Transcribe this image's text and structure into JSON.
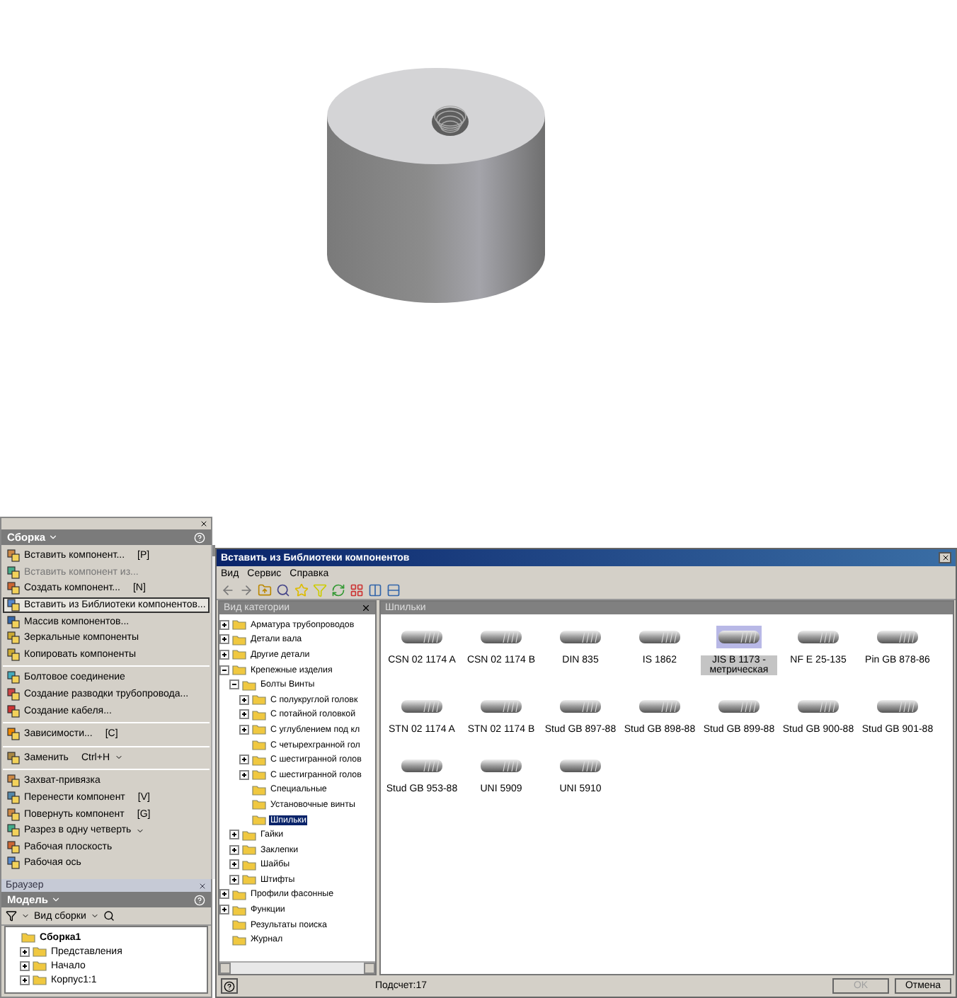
{
  "panel": {
    "title": "Сборка",
    "items": [
      {
        "kind": "item",
        "label": "Вставить компонент...",
        "shortcut": "[P]",
        "disabled": false,
        "selected": false,
        "dropdown": false
      },
      {
        "kind": "item",
        "label": "Вставить компонент из...",
        "disabled": true,
        "selected": false,
        "dropdown": false
      },
      {
        "kind": "item",
        "label": "Создать компонент...",
        "shortcut": "[N]",
        "disabled": false,
        "selected": false,
        "dropdown": false
      },
      {
        "kind": "item",
        "label": "Вставить из Библиотеки компонентов...",
        "disabled": false,
        "selected": true,
        "dropdown": false
      },
      {
        "kind": "item",
        "label": "Массив компонентов...",
        "disabled": false,
        "selected": false,
        "dropdown": false
      },
      {
        "kind": "item",
        "label": "Зеркальные компоненты",
        "disabled": false,
        "selected": false,
        "dropdown": false
      },
      {
        "kind": "item",
        "label": "Копировать компоненты",
        "disabled": false,
        "selected": false,
        "dropdown": false
      },
      {
        "kind": "separator"
      },
      {
        "kind": "item",
        "label": "Болтовое соединение",
        "disabled": false,
        "selected": false,
        "dropdown": false
      },
      {
        "kind": "item",
        "label": "Создание разводки трубопровода...",
        "disabled": false,
        "selected": false,
        "dropdown": false
      },
      {
        "kind": "item",
        "label": "Создание кабеля...",
        "disabled": false,
        "selected": false,
        "dropdown": false
      },
      {
        "kind": "separator"
      },
      {
        "kind": "item",
        "label": "Зависимости...",
        "shortcut": "[C]",
        "disabled": false,
        "selected": false,
        "dropdown": false
      },
      {
        "kind": "separator"
      },
      {
        "kind": "item",
        "label": "Заменить",
        "shortcut": "Ctrl+H",
        "disabled": false,
        "selected": false,
        "dropdown": true
      },
      {
        "kind": "separator"
      },
      {
        "kind": "item",
        "label": "Захват-привязка",
        "disabled": false,
        "selected": false,
        "dropdown": false
      },
      {
        "kind": "item",
        "label": "Перенести компонент",
        "shortcut": "[V]",
        "disabled": false,
        "selected": false,
        "dropdown": false
      },
      {
        "kind": "item",
        "label": "Повернуть компонент",
        "shortcut": "[G]",
        "disabled": false,
        "selected": false,
        "dropdown": false
      },
      {
        "kind": "item",
        "label": "Разрез в одну четверть",
        "disabled": false,
        "selected": false,
        "dropdown": true
      },
      {
        "kind": "item",
        "label": "Рабочая плоскость",
        "disabled": false,
        "selected": false,
        "dropdown": false
      },
      {
        "kind": "item",
        "label": "Рабочая ось",
        "disabled": false,
        "selected": false,
        "dropdown": false
      }
    ]
  },
  "browser": {
    "title": "Браузер",
    "tab": "Модель",
    "view": "Вид сборки",
    "tree": [
      {
        "label": "Сборка1",
        "selected": false,
        "children": [
          {
            "label": "Представления",
            "expanded": false,
            "selected": false
          },
          {
            "label": "Начало",
            "expanded": false,
            "selected": false
          },
          {
            "label": "Корпус1:1",
            "expanded": false,
            "selected": false
          }
        ]
      }
    ]
  },
  "dialog": {
    "title": "Вставить из Библиотеки компонентов",
    "menu": [
      "Вид",
      "Сервис",
      "Справка"
    ],
    "categories_title": "Вид категории",
    "tree": [
      {
        "label": "Арматура трубопроводов",
        "expanded": false,
        "selected": false
      },
      {
        "label": "Детали вала",
        "expanded": false,
        "selected": false
      },
      {
        "label": "Другие детали",
        "expanded": false,
        "selected": false
      },
      {
        "label": "Крепежные изделия",
        "expanded": true,
        "selected": false,
        "children": [
          {
            "label": "Болты Винты",
            "expanded": true,
            "selected": false,
            "children": [
              {
                "label": "С полукруглой головк",
                "expanded": false,
                "selected": false
              },
              {
                "label": "С потайной головкой",
                "expanded": false,
                "selected": false
              },
              {
                "label": "С углублением под кл",
                "expanded": false,
                "selected": false
              },
              {
                "label": "С четырехгранной гол",
                "selected": false
              },
              {
                "label": "С шестигранной голов",
                "expanded": false,
                "selected": false
              },
              {
                "label": "С шестигранной голов",
                "expanded": false,
                "selected": false
              },
              {
                "label": "Специальные",
                "selected": false
              },
              {
                "label": "Установочные винты",
                "selected": false
              },
              {
                "label": "Шпильки",
                "selected": true
              }
            ]
          },
          {
            "label": "Гайки",
            "expanded": false,
            "selected": false
          },
          {
            "label": "Заклепки",
            "expanded": false,
            "selected": false
          },
          {
            "label": "Шайбы",
            "expanded": false,
            "selected": false
          },
          {
            "label": "Штифты",
            "expanded": false,
            "selected": false
          }
        ]
      },
      {
        "label": "Профили фасонные",
        "expanded": false,
        "selected": false
      },
      {
        "label": "Функции",
        "expanded": false,
        "selected": false
      },
      {
        "label": "Результаты поиска",
        "selected": false
      },
      {
        "label": "Журнал",
        "selected": false
      }
    ],
    "items_title": "Шпильки",
    "items": [
      {
        "label": "CSN 02 1174 A",
        "selected": false
      },
      {
        "label": "CSN 02 1174 B",
        "selected": false
      },
      {
        "label": "DIN 835",
        "selected": false
      },
      {
        "label": "IS 1862",
        "selected": false
      },
      {
        "label": "JIS B 1173 - метрическая",
        "selected": true
      },
      {
        "label": "NF E 25-135",
        "selected": false
      },
      {
        "label": "Pin GB 878-86",
        "selected": false
      },
      {
        "label": "STN 02 1174 A",
        "selected": false
      },
      {
        "label": "STN 02 1174 B",
        "selected": false
      },
      {
        "label": "Stud GB 897-88",
        "selected": false
      },
      {
        "label": "Stud GB 898-88",
        "selected": false
      },
      {
        "label": "Stud GB 899-88",
        "selected": false
      },
      {
        "label": "Stud GB 900-88",
        "selected": false
      },
      {
        "label": "Stud GB 901-88",
        "selected": false
      },
      {
        "label": "Stud GB 953-88",
        "selected": false
      },
      {
        "label": "UNI 5909",
        "selected": false
      },
      {
        "label": "UNI 5910",
        "selected": false
      }
    ],
    "count": "Подсчет:17",
    "buttons": [
      {
        "label": "OK",
        "disabled": true
      },
      {
        "label": "Отмена",
        "disabled": false
      }
    ]
  }
}
